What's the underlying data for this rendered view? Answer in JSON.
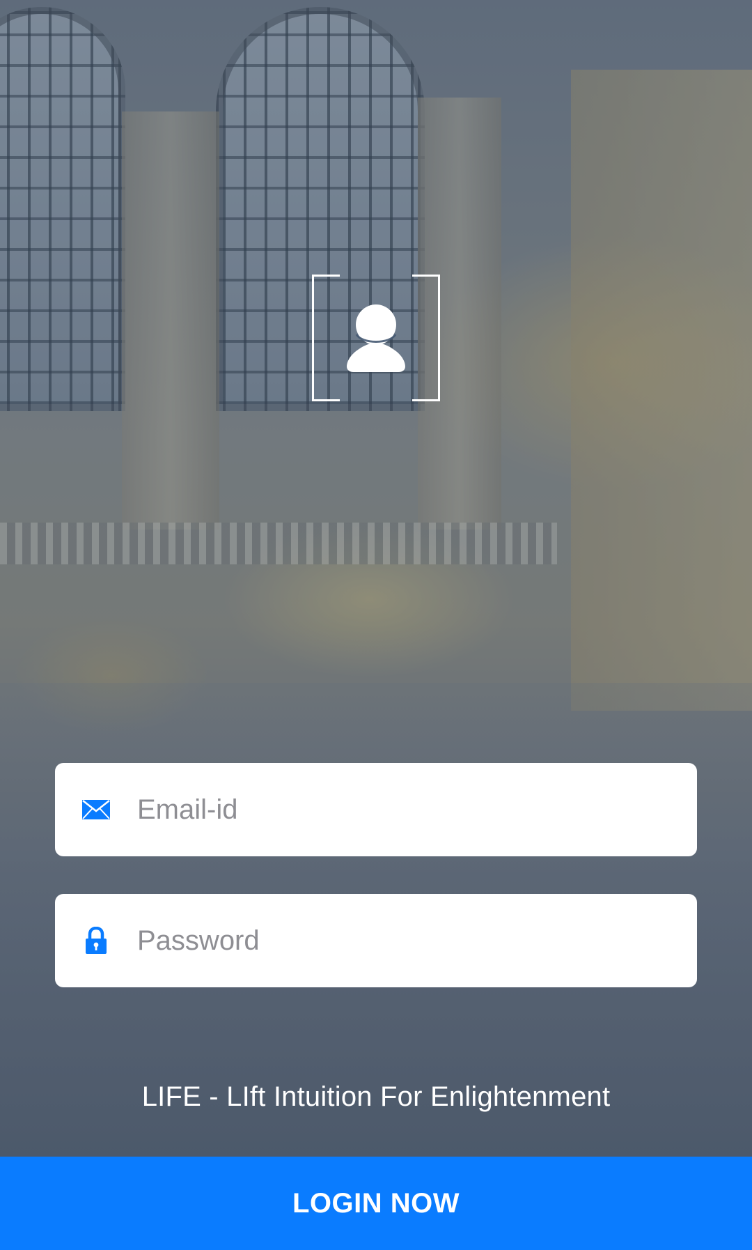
{
  "colors": {
    "accent": "#0a7cff",
    "field_background": "#ffffff",
    "placeholder": "#8e8e93",
    "text_on_dark": "#ffffff"
  },
  "avatar": {
    "icon": "user-icon"
  },
  "form": {
    "email": {
      "icon": "envelope-icon",
      "value": "",
      "placeholder": "Email-id"
    },
    "password": {
      "icon": "lock-icon",
      "value": "",
      "placeholder": "Password"
    }
  },
  "tagline": "LIFE - LIft Intuition For Enlightenment",
  "login_button": {
    "label": "LOGIN NOW"
  }
}
